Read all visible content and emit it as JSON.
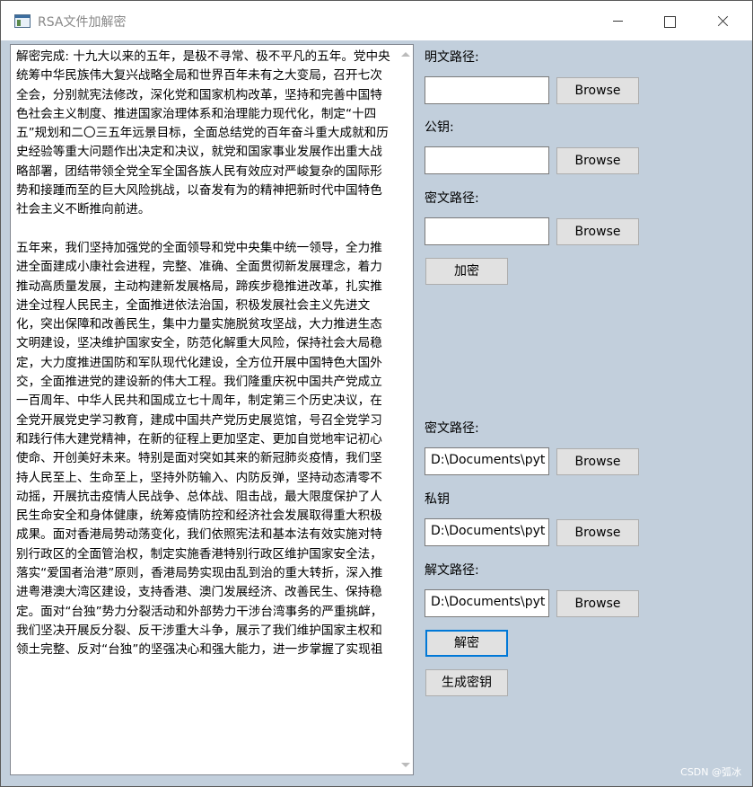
{
  "window": {
    "title": "RSA文件加解密"
  },
  "decrypted_text": "解密完成: 十九大以来的五年，是极不寻常、极不平凡的五年。党中央统筹中华民族伟大复兴战略全局和世界百年未有之大变局，召开七次全会，分别就宪法修改，深化党和国家机构改革，坚持和完善中国特色社会主义制度、推进国家治理体系和治理能力现代化，制定“十四五”规划和二〇三五年远景目标，全面总结党的百年奋斗重大成就和历史经验等重大问题作出决定和决议，就党和国家事业发展作出重大战略部署，团结带领全党全军全国各族人民有效应对严峻复杂的国际形势和接踵而至的巨大风险挑战，以奋发有为的精神把新时代中国特色社会主义不断推向前进。\n\n五年来，我们坚持加强党的全面领导和党中央集中统一领导，全力推进全面建成小康社会进程，完整、准确、全面贯彻新发展理念，着力推动高质量发展，主动构建新发展格局，蹄疾步稳推进改革，扎实推进全过程人民民主，全面推进依法治国，积极发展社会主义先进文化，突出保障和改善民生，集中力量实施脱贫攻坚战，大力推进生态文明建设，坚决维护国家安全，防范化解重大风险，保持社会大局稳定，大力度推进国防和军队现代化建设，全方位开展中国特色大国外交，全面推进党的建设新的伟大工程。我们隆重庆祝中国共产党成立一百周年、中华人民共和国成立七十周年，制定第三个历史决议，在全党开展党史学习教育，建成中国共产党历史展览馆，号召全党学习和践行伟大建党精神，在新的征程上更加坚定、更加自觉地牢记初心使命、开创美好未来。特别是面对突如其来的新冠肺炎疫情，我们坚持人民至上、生命至上，坚持外防输入、内防反弹，坚持动态清零不动摇，开展抗击疫情人民战争、总体战、阻击战，最大限度保护了人民生命安全和身体健康，统筹疫情防控和经济社会发展取得重大积极成果。面对香港局势动荡变化，我们依照宪法和基本法有效实施对特别行政区的全面管治权，制定实施香港特别行政区维护国家安全法，落实“爱国者治港”原则，香港局势实现由乱到治的重大转折，深入推进粤港澳大湾区建设，支持香港、澳门发展经济、改善民生、保持稳定。面对“台独”势力分裂活动和外部势力干涉台湾事务的严重挑衅，我们坚决开展反分裂、反干涉重大斗争，展示了我们维护国家主权和领土完整、反对“台独”的坚强决心和强大能力，进一步掌握了实现祖",
  "encrypt": {
    "plaintext_label": "明文路径:",
    "plaintext_value": "",
    "pubkey_label": "公钥:",
    "pubkey_value": "",
    "ciphertext_label": "密文路径:",
    "ciphertext_value": "",
    "browse_label": "Browse",
    "encrypt_button": "加密"
  },
  "decrypt": {
    "ciphertext_label": "密文路径:",
    "ciphertext_value": "D:\\Documents\\pyt",
    "privkey_label": "私钥",
    "privkey_value": "D:\\Documents\\pyt",
    "output_label": "解文路径:",
    "output_value": "D:\\Documents\\pyt",
    "browse_label": "Browse",
    "decrypt_button": "解密",
    "genkey_button": "生成密钥"
  },
  "watermark": "CSDN @弧冰"
}
